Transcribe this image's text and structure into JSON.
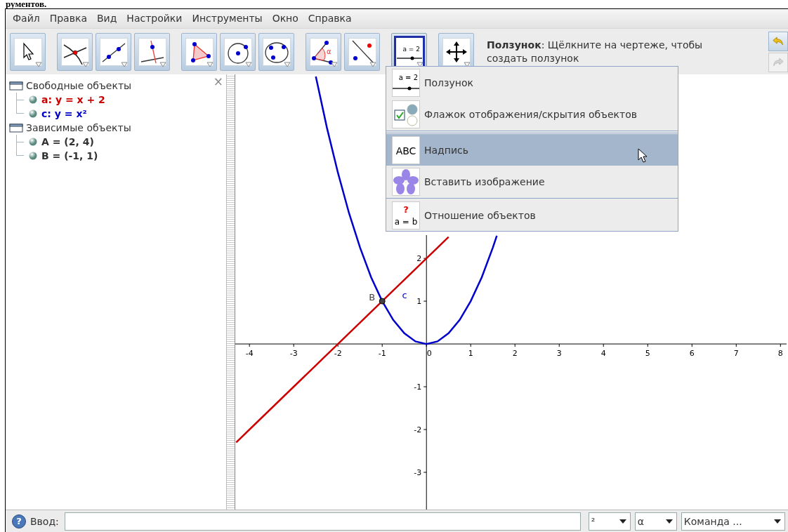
{
  "document_text": "рументов.",
  "menu_bar": [
    "Файл",
    "Правка",
    "Вид",
    "Настройки",
    "Инструменты",
    "Окно",
    "Справка"
  ],
  "toolbar": {
    "tools": [
      {
        "kind": "move",
        "selected": false
      },
      {
        "kind": "intersect",
        "selected": false
      },
      {
        "kind": "line",
        "selected": false
      },
      {
        "kind": "perpendicular",
        "selected": false
      },
      {
        "kind": "polygon",
        "selected": false
      },
      {
        "kind": "circle",
        "selected": false
      },
      {
        "kind": "conic",
        "selected": false
      },
      {
        "kind": "angle",
        "selected": false,
        "icon_text": "α"
      },
      {
        "kind": "reflect",
        "selected": false
      },
      {
        "kind": "slider",
        "selected": true,
        "icon_text": "a = 2"
      },
      {
        "kind": "move-view",
        "selected": false
      }
    ],
    "help": "**Ползунок**: Щёлкните на чертеже, чтобы создать ползунок",
    "undo": {
      "disabled": false
    },
    "redo": {
      "disabled": true
    }
  },
  "tool_menu": {
    "items": [
      {
        "kind": "slider",
        "label": "Ползунок",
        "selected": false,
        "icon_text": "a = 2"
      },
      {
        "kind": "checkbox",
        "label": "Флажок отображения/скрытия объектов",
        "selected": false
      },
      {
        "kind": "text",
        "label": "Надпись",
        "selected": true,
        "icon_text": "ABC"
      },
      {
        "kind": "image",
        "label": "Вставить изображение",
        "selected": false
      },
      {
        "kind": "relation",
        "label": "Отношение объектов",
        "selected": false,
        "icon_text": "a = b",
        "icon_mark": "?"
      }
    ]
  },
  "algebra": {
    "close": "×",
    "groups": [
      {
        "label": "Свободные объекты",
        "children": [
          {
            "text": "a: y = x + 2",
            "color": "#cc0000"
          },
          {
            "text": "c: y = x²",
            "color": "#0000cc"
          }
        ]
      },
      {
        "label": "Зависимые объекты",
        "children": [
          {
            "text": "A = (2, 4)",
            "color": "#333333"
          },
          {
            "text": "B = (-1, 1)",
            "color": "#333333"
          }
        ]
      }
    ]
  },
  "graphics": {
    "chart_data": {
      "type": "line",
      "x": [
        -4.3,
        -4,
        -3.5,
        -3,
        -2.5,
        -2.25,
        -2,
        -1.75,
        -1.5,
        -1.25,
        -1,
        -0.75,
        -0.5,
        -0.25,
        0,
        0.25,
        0.5,
        0.75,
        1,
        1.25,
        1.5,
        1.59
      ],
      "series": [
        {
          "color": "#cc0000",
          "values": [
            -2.3,
            -2,
            -1.5,
            -1,
            -0.5,
            -0.25,
            0,
            0.25,
            0.5,
            0.75,
            1,
            1.25,
            1.5,
            1.75,
            2,
            2.25,
            2.5,
            null,
            null,
            null,
            null,
            null
          ]
        },
        {
          "name": "c",
          "color": "#0000cc",
          "values": [
            null,
            null,
            null,
            null,
            6.25,
            5.06,
            4,
            3.06,
            2.25,
            1.56,
            1,
            0.56,
            0.25,
            0.06,
            0,
            0.06,
            0.25,
            0.56,
            1,
            1.56,
            2.25,
            2.53
          ]
        }
      ],
      "xlim": [
        -4.32,
        8.17
      ],
      "ylim": [
        -3.87,
        6.3
      ],
      "xticks": [
        -4,
        -3,
        -2,
        -1,
        0,
        1,
        2,
        3,
        4,
        5,
        6,
        7,
        8
      ],
      "yticks": [
        -3,
        -2,
        -1,
        1,
        2
      ],
      "annotations": [
        {
          "text": "B",
          "x": -1,
          "y": 1
        }
      ]
    }
  },
  "input_bar": {
    "help": "?",
    "label": "Ввод:",
    "symbols": [
      "²",
      "α"
    ],
    "command": "Команда ..."
  }
}
